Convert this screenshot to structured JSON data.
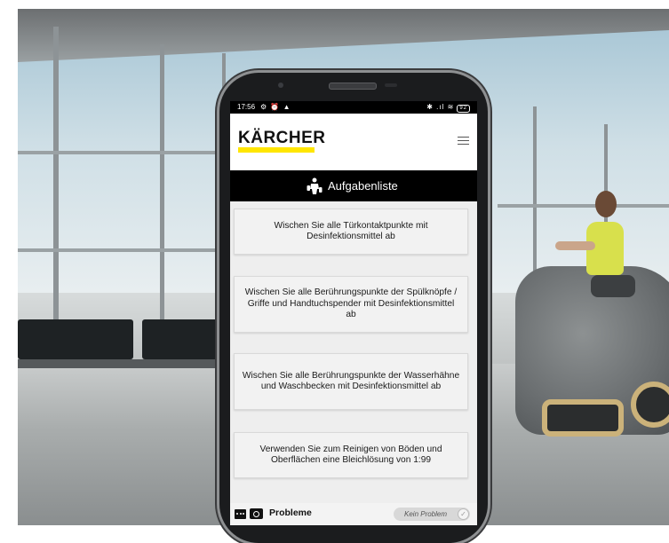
{
  "status_bar": {
    "time": "17:56",
    "left_icons": "⚙ ⏰ ▲",
    "right_icons": "✱ .ıl ≋",
    "battery": "92"
  },
  "app": {
    "brand": "KÄRCHER",
    "brand_accent_color": "#ffe600",
    "menu_icon": "hamburger-menu-icon"
  },
  "header": {
    "title": "Aufgabenliste",
    "icon": "cleaning-worker-icon"
  },
  "tasks": [
    {
      "text": "Wischen Sie alle Türkontaktpunkte mit Desinfektionsmittel ab"
    },
    {
      "text": "Wischen Sie alle Berührungspunkte der Spülknöpfe / Griffe und Handtuchspender mit Desinfektionsmittel ab"
    },
    {
      "text": "Wischen Sie alle Berührungspunkte der Wasserhähne und Waschbecken mit Desinfektionsmittel ab"
    },
    {
      "text": "Verwenden Sie zum Reinigen von Böden und Oberflächen eine Bleichlösung von 1:99"
    }
  ],
  "footer": {
    "problems_label": "Probleme",
    "toggle_label": "Kein Problem",
    "toggle_check": "✓",
    "icons": [
      "chat-icon",
      "camera-icon"
    ]
  }
}
